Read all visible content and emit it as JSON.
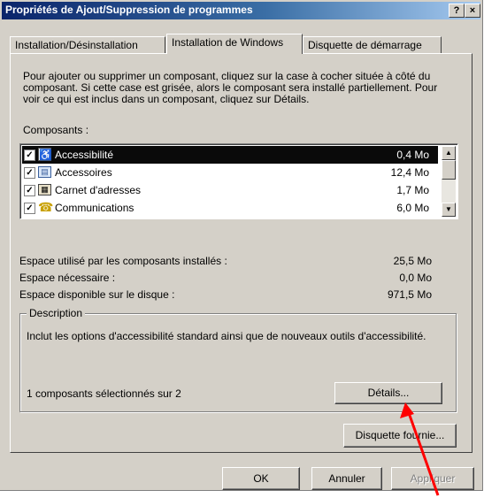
{
  "window": {
    "title": "Propriétés de Ajout/Suppression de programmes",
    "help_button": "?",
    "close_button": "×"
  },
  "tabs": [
    {
      "label": "Installation/Désinstallation",
      "active": false
    },
    {
      "label": "Installation de Windows",
      "active": true
    },
    {
      "label": "Disquette de démarrage",
      "active": false
    }
  ],
  "intro_text": "Pour ajouter ou supprimer un composant, cliquez sur la case à cocher située à côté du composant. Si cette case est grisée, alors le composant sera installé partiellement. Pour voir ce qui est inclus dans un composant, cliquez sur Détails.",
  "components_label": "Composants :",
  "components": [
    {
      "name": "Accessibilité",
      "size": "0,4 Mo",
      "checked": true,
      "selected": true,
      "icon": "accessibility-icon"
    },
    {
      "name": "Accessoires",
      "size": "12,4 Mo",
      "checked": true,
      "selected": false,
      "icon": "accessories-icon"
    },
    {
      "name": "Carnet d'adresses",
      "size": "1,7 Mo",
      "checked": true,
      "selected": false,
      "icon": "address-book-icon"
    },
    {
      "name": "Communications",
      "size": "6,0 Mo",
      "checked": true,
      "selected": false,
      "icon": "communications-icon"
    }
  ],
  "space": {
    "used_label": "Espace utilisé par les composants installés :",
    "used_value": "25,5 Mo",
    "needed_label": "Espace nécessaire :",
    "needed_value": "0,0 Mo",
    "free_label": "Espace disponible sur le disque :",
    "free_value": "971,5 Mo"
  },
  "description": {
    "group_label": "Description",
    "text": "Inclut les options d'accessibilité standard ainsi que de nouveaux outils d'accessibilité.",
    "selection_count": "1 composants sélectionnés sur 2",
    "details_button": "Détails..."
  },
  "disk_button": "Disquette fournie...",
  "footer": {
    "ok": "OK",
    "cancel": "Annuler",
    "apply": "Appliquer"
  },
  "colors": {
    "annotation_arrow": "#ff0000"
  }
}
